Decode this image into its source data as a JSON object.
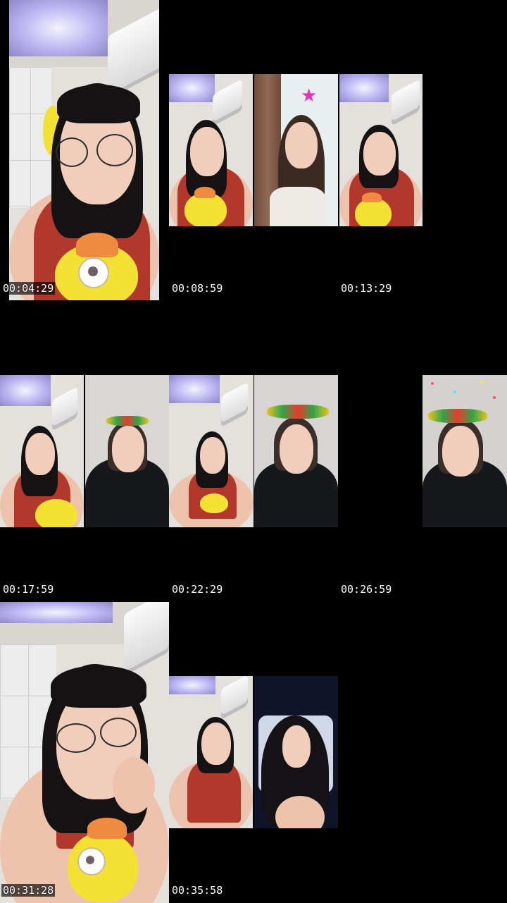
{
  "timestamps": [
    "00:04:29",
    "00:08:59",
    "00:13:29",
    "00:17:59",
    "00:22:29",
    "00:26:59",
    "00:31:28",
    "00:35:58"
  ],
  "colors": {
    "background": "#000000",
    "timestamp_text": "#ffffff",
    "shirt_red": "#b2382c",
    "plush_yellow": "#f3e233"
  },
  "frames": [
    {
      "scene": "woman-with-glasses-red-top-and-yellow-plush"
    },
    {
      "scene": "split-three-panel-livestream"
    },
    {
      "scene": "split-four-panel-livestream"
    },
    {
      "scene": "single-panel-black-jacket-with-headband"
    },
    {
      "scene": "close-up-woman-with-glasses-resting-chin"
    },
    {
      "scene": "split-two-panel-red-top-and-long-hair"
    }
  ]
}
